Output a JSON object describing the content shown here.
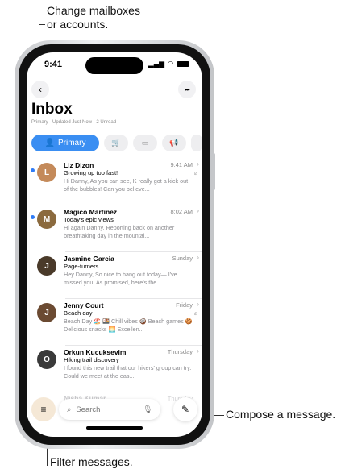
{
  "callouts": {
    "mailboxes": [
      "Change mailboxes",
      "or accounts."
    ],
    "compose": "Compose a message.",
    "filter": "Filter messages."
  },
  "status_bar": {
    "time": "9:41"
  },
  "header": {
    "title": "Inbox",
    "subtitle": "Primary · Updated Just Now · 2 Unread",
    "more_glyph": "•••"
  },
  "tabs": [
    {
      "label": "Primary",
      "icon": "person-icon",
      "active": true
    },
    {
      "label": "",
      "icon": "cart-icon"
    },
    {
      "label": "",
      "icon": "message-icon"
    },
    {
      "label": "",
      "icon": "megaphone-icon"
    }
  ],
  "messages": [
    {
      "sender": "Liz Dizon",
      "date": "9:41 AM",
      "subject": "Growing up too fast!",
      "preview": "Hi Danny, As you can see, K really got a kick out of the bubbles! Can you believe...",
      "unread": true,
      "attachment": true,
      "avatar_color": "#c48a5a"
    },
    {
      "sender": "Magico Martinez",
      "date": "8:02 AM",
      "subject": "Today's epic views",
      "preview": "Hi again Danny, Reporting back on another breathtaking day in the mountai...",
      "unread": true,
      "attachment": false,
      "avatar_color": "#8b6a3e"
    },
    {
      "sender": "Jasmine Garcia",
      "date": "Sunday",
      "subject": "Page-turners",
      "preview": "Hey Danny, So nice to hang out today— I've missed you! As promised, here's the...",
      "unread": false,
      "attachment": false,
      "avatar_color": "#4a3a2a"
    },
    {
      "sender": "Jenny Court",
      "date": "Friday",
      "subject": "Beach day",
      "preview": "Beach Day 🏖️ 🍱 Chill vibes 🥥 Beach games 🍪 Delicious snacks 🌅 Excellen...",
      "unread": false,
      "attachment": true,
      "avatar_color": "#6b4a32"
    },
    {
      "sender": "Orkun Kucuksevim",
      "date": "Thursday",
      "subject": "Hiking trail discovery",
      "preview": "I found this new trail that our hikers' group can try. Could we meet at the eas...",
      "unread": false,
      "attachment": false,
      "avatar_color": "#3a3a3a"
    }
  ],
  "partial_message": {
    "sender": "Nisha Kumar",
    "date": "Thursday"
  },
  "bottom_bar": {
    "search_placeholder": "Search"
  }
}
